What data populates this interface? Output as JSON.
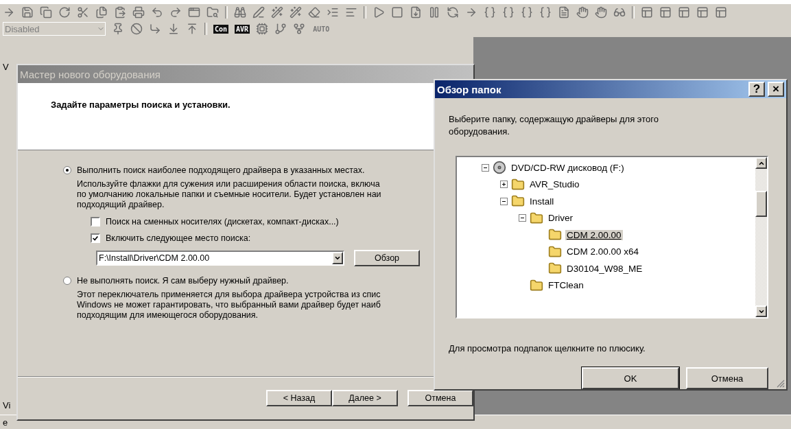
{
  "toolbar": {
    "mode_select": {
      "value": "Disabled",
      "disabled": true
    },
    "badges": [
      {
        "label": "Con",
        "kind": "dark"
      },
      {
        "label": "AVR",
        "kind": "dark"
      },
      {
        "label": "AUTO",
        "kind": "plain"
      }
    ]
  },
  "background_fragments": {
    "top": "V",
    "bottom": "Vi",
    "status": "e"
  },
  "wizard": {
    "title": "Мастер нового оборудования",
    "active": false,
    "heading": "Задайте параметры поиска и установки.",
    "options": [
      {
        "label": "Выполнить поиск наиболее подходящего драйвера в указанных местах.",
        "selected": true,
        "description": [
          "Используйте флажки для сужения или расширения области поиска, включа",
          "по умолчанию локальные папки и съемные носители. Будет установлен наи",
          "подходящий драйвер."
        ]
      },
      {
        "label": "Не выполнять поиск. Я сам выберу нужный драйвер.",
        "selected": false,
        "description": [
          "Этот переключатель применяется для выбора драйвера устройства из спис",
          "Windows не может гарантировать, что выбранный вами драйвер будет наиб",
          "подходящим для имеющегося оборудования."
        ]
      }
    ],
    "checkboxes": [
      {
        "label": "Поиск на сменных носителях (дискетах, компакт-дисках...)",
        "checked": false
      },
      {
        "label": "Включить следующее место поиска:",
        "checked": true
      }
    ],
    "location": {
      "value": "F:\\Install\\Driver\\CDM 2.00.00"
    },
    "browse_button": "Обзор",
    "buttons": [
      "< Назад",
      "Далее >",
      "Отмена"
    ]
  },
  "browse_dialog": {
    "title": "Обзор папок",
    "active": true,
    "help_button": "?",
    "close_button": "×",
    "prompt": "Выберите папку, содержащую драйверы для этого оборудования.",
    "tree": [
      {
        "label": "DVD/CD-RW дисковод (F:)",
        "kind": "drive",
        "expanded": true,
        "selected": false,
        "children": [
          {
            "label": "AVR_Studio",
            "kind": "folder",
            "expanded": false,
            "selected": false
          },
          {
            "label": "Install",
            "kind": "folder",
            "expanded": true,
            "selected": false,
            "children": [
              {
                "label": "Driver",
                "kind": "folder",
                "expanded": true,
                "selected": false,
                "children": [
                  {
                    "label": "CDM 2.00.00",
                    "kind": "folder",
                    "selected": true
                  },
                  {
                    "label": "CDM 2.00.00 x64",
                    "kind": "folder",
                    "selected": false
                  },
                  {
                    "label": "D30104_W98_ME",
                    "kind": "folder",
                    "selected": false
                  }
                ]
              },
              {
                "label": "FTClean",
                "kind": "folder",
                "selected": false
              }
            ]
          }
        ]
      }
    ],
    "hint": "Для просмотра подпапок щелкните по плюсику.",
    "buttons": [
      {
        "label": "OK",
        "default": true
      },
      {
        "label": "Отмена",
        "default": false
      }
    ]
  }
}
